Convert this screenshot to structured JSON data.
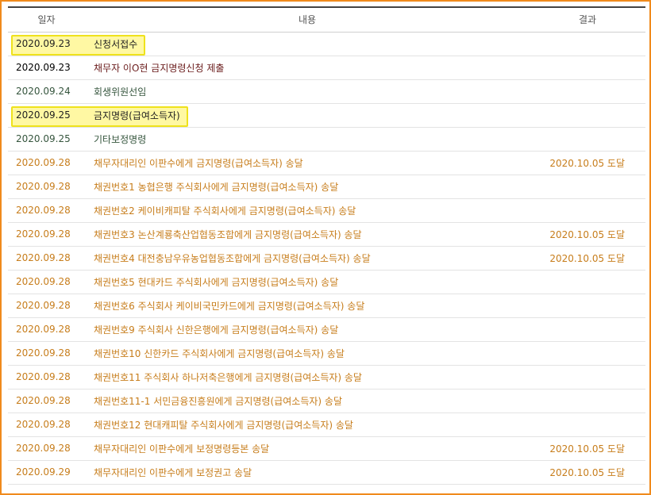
{
  "header": {
    "date": "일자",
    "content": "내용",
    "result": "결과"
  },
  "colors": {
    "frame": "#f08a1c",
    "highlight": "#fff8a3",
    "highlight_border": "#efe21c",
    "text_dark": "#333333",
    "text_maroon": "#6b1d1d",
    "text_green": "#35553d",
    "text_orange": "#c77d1b"
  },
  "rows": [
    {
      "date": "2020.09.23",
      "content": "신청서접수",
      "result": "",
      "style": "hl"
    },
    {
      "date": "2020.09.23",
      "content": "채무자 이O현 금지명령신청 제출",
      "result": "",
      "style": "maroon"
    },
    {
      "date": "2020.09.24",
      "content": "회생위원선임",
      "result": "",
      "style": "green"
    },
    {
      "date": "2020.09.25",
      "content": "금지명령(급여소득자)",
      "result": "",
      "style": "hl"
    },
    {
      "date": "2020.09.25",
      "content": "기타보정명령",
      "result": "",
      "style": "green"
    },
    {
      "date": "2020.09.28",
      "content": "채무자대리인 이판수에게 금지명령(급여소득자) 송달",
      "result": "2020.10.05 도달",
      "style": "orange"
    },
    {
      "date": "2020.09.28",
      "content": "채권번호1 농협은행 주식회사에게 금지명령(급여소득자) 송달",
      "result": "",
      "style": "orange"
    },
    {
      "date": "2020.09.28",
      "content": "채권번호2 케이비캐피탈 주식회사에게 금지명령(급여소득자) 송달",
      "result": "",
      "style": "orange"
    },
    {
      "date": "2020.09.28",
      "content": "채권번호3 논산계룡축산업협동조합에게 금지명령(급여소득자) 송달",
      "result": "2020.10.05 도달",
      "style": "orange"
    },
    {
      "date": "2020.09.28",
      "content": "채권번호4 대전충남우유농업협동조합에게 금지명령(급여소득자) 송달",
      "result": "2020.10.05 도달",
      "style": "orange"
    },
    {
      "date": "2020.09.28",
      "content": "채권번호5 현대카드 주식회사에게 금지명령(급여소득자) 송달",
      "result": "",
      "style": "orange"
    },
    {
      "date": "2020.09.28",
      "content": "채권번호6 주식회사 케이비국민카드에게 금지명령(급여소득자) 송달",
      "result": "",
      "style": "orange"
    },
    {
      "date": "2020.09.28",
      "content": "채권번호9 주식회사 신한은행에게 금지명령(급여소득자) 송달",
      "result": "",
      "style": "orange"
    },
    {
      "date": "2020.09.28",
      "content": "채권번호10 신한카드 주식회사에게 금지명령(급여소득자) 송달",
      "result": "",
      "style": "orange"
    },
    {
      "date": "2020.09.28",
      "content": "채권번호11 주식회사 하나저축은행에게 금지명령(급여소득자) 송달",
      "result": "",
      "style": "orange"
    },
    {
      "date": "2020.09.28",
      "content": "채권번호11-1 서민금융진흥원에게 금지명령(급여소득자) 송달",
      "result": "",
      "style": "orange"
    },
    {
      "date": "2020.09.28",
      "content": "채권번호12 현대캐피탈 주식회사에게 금지명령(급여소득자) 송달",
      "result": "",
      "style": "orange"
    },
    {
      "date": "2020.09.28",
      "content": "채무자대리인 이판수에게 보정명령등본 송달",
      "result": "2020.10.05 도달",
      "style": "orange"
    },
    {
      "date": "2020.09.29",
      "content": "채무자대리인 이판수에게 보정권고 송달",
      "result": "2020.10.05 도달",
      "style": "orange"
    }
  ]
}
